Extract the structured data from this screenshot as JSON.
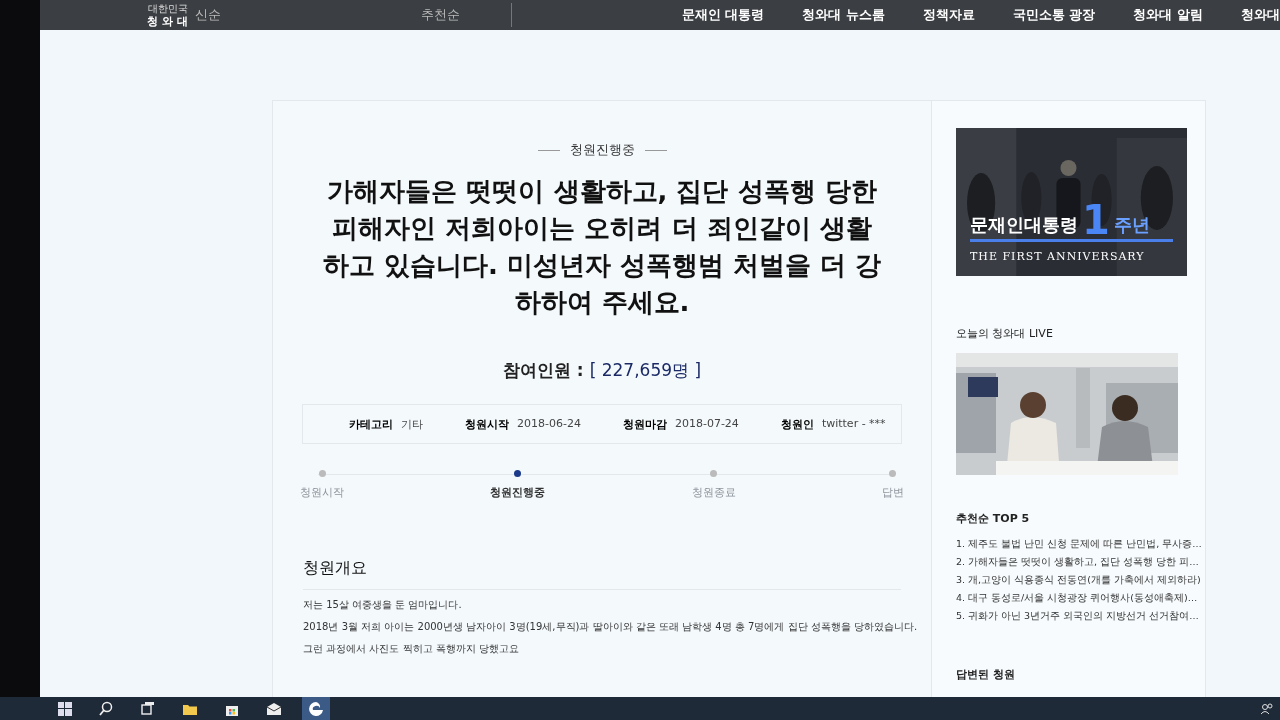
{
  "header": {
    "logo_small": "대한민국",
    "logo": "청 와 대",
    "sort_tabs": [
      "신순",
      "추천순"
    ],
    "nav": [
      {
        "label": "문재인 대통령"
      },
      {
        "label": "청와대 뉴스룸"
      },
      {
        "label": "정책자료"
      },
      {
        "label": "국민소통 광장"
      },
      {
        "label": "청와대 알림"
      },
      {
        "label": "청와대"
      }
    ]
  },
  "petition": {
    "status": "청원진행중",
    "title": "가해자들은 떳떳이 생활하고, 집단 성폭행 당한 피해자인 저희아이는 오히려 더 죄인같이 생활하고 있습니다. 미성년자 성폭행범 처벌을 더 강하하여 주세요.",
    "participants_label": "참여인원 :",
    "participants_count": "[ 227,659명 ]",
    "meta": [
      {
        "label": "카테고리",
        "value": "기타"
      },
      {
        "label": "청원시작",
        "value": "2018-06-24"
      },
      {
        "label": "청원마감",
        "value": "2018-07-24"
      },
      {
        "label": "청원인",
        "value": "twitter - ***"
      }
    ],
    "steps": [
      {
        "label": "청원시작",
        "selected": false
      },
      {
        "label": "청원진행중",
        "selected": true
      },
      {
        "label": "청원종료",
        "selected": false
      },
      {
        "label": "답변",
        "selected": false
      }
    ],
    "summary_heading": "청원개요",
    "body": [
      "저는 15살 여중생을 둔 엄마입니다.",
      "2018년 3월 저희 아이는 2000년생 남자아이 3명(19세,무직)과 딸아이와 같은 또래 남학생 4명 총 7명에게 집단 성폭행을 당하였습니다.",
      "그런 과정에서 사진도 찍히고 폭행까지 당했고요"
    ]
  },
  "sidebar": {
    "banner": {
      "title": "문재인대통령",
      "number": "1",
      "suffix": "주년",
      "subtitle": "THE FIRST ANNIVERSARY"
    },
    "live_heading": "오늘의 청와대 LIVE",
    "top5_heading": "추천순 TOP 5",
    "top5": [
      "1. 제주도 불법 난민 신청 문제에 따른 난민법, 무사증…",
      "2. 가해자들은 떳떳이 생활하고, 집단 성폭행 당한 피…",
      "3. 개,고양이 식용종식 전동연(개를 가축에서 제외하라)",
      "4. 대구 동성로/서울 시청광장 퀴어행사(동성애축제)…",
      "5. 귀화가 아닌 3년거주 외국인의 지방선거 선거참여…"
    ],
    "answered_heading": "답변된 청원"
  },
  "taskbar": {
    "apps": [
      {
        "kind": "search",
        "selected": false
      },
      {
        "kind": "taskview",
        "selected": false
      },
      {
        "kind": "folder",
        "selected": false
      },
      {
        "kind": "store",
        "selected": false
      },
      {
        "kind": "mail",
        "selected": false
      },
      {
        "kind": "edge",
        "selected": true
      }
    ]
  }
}
